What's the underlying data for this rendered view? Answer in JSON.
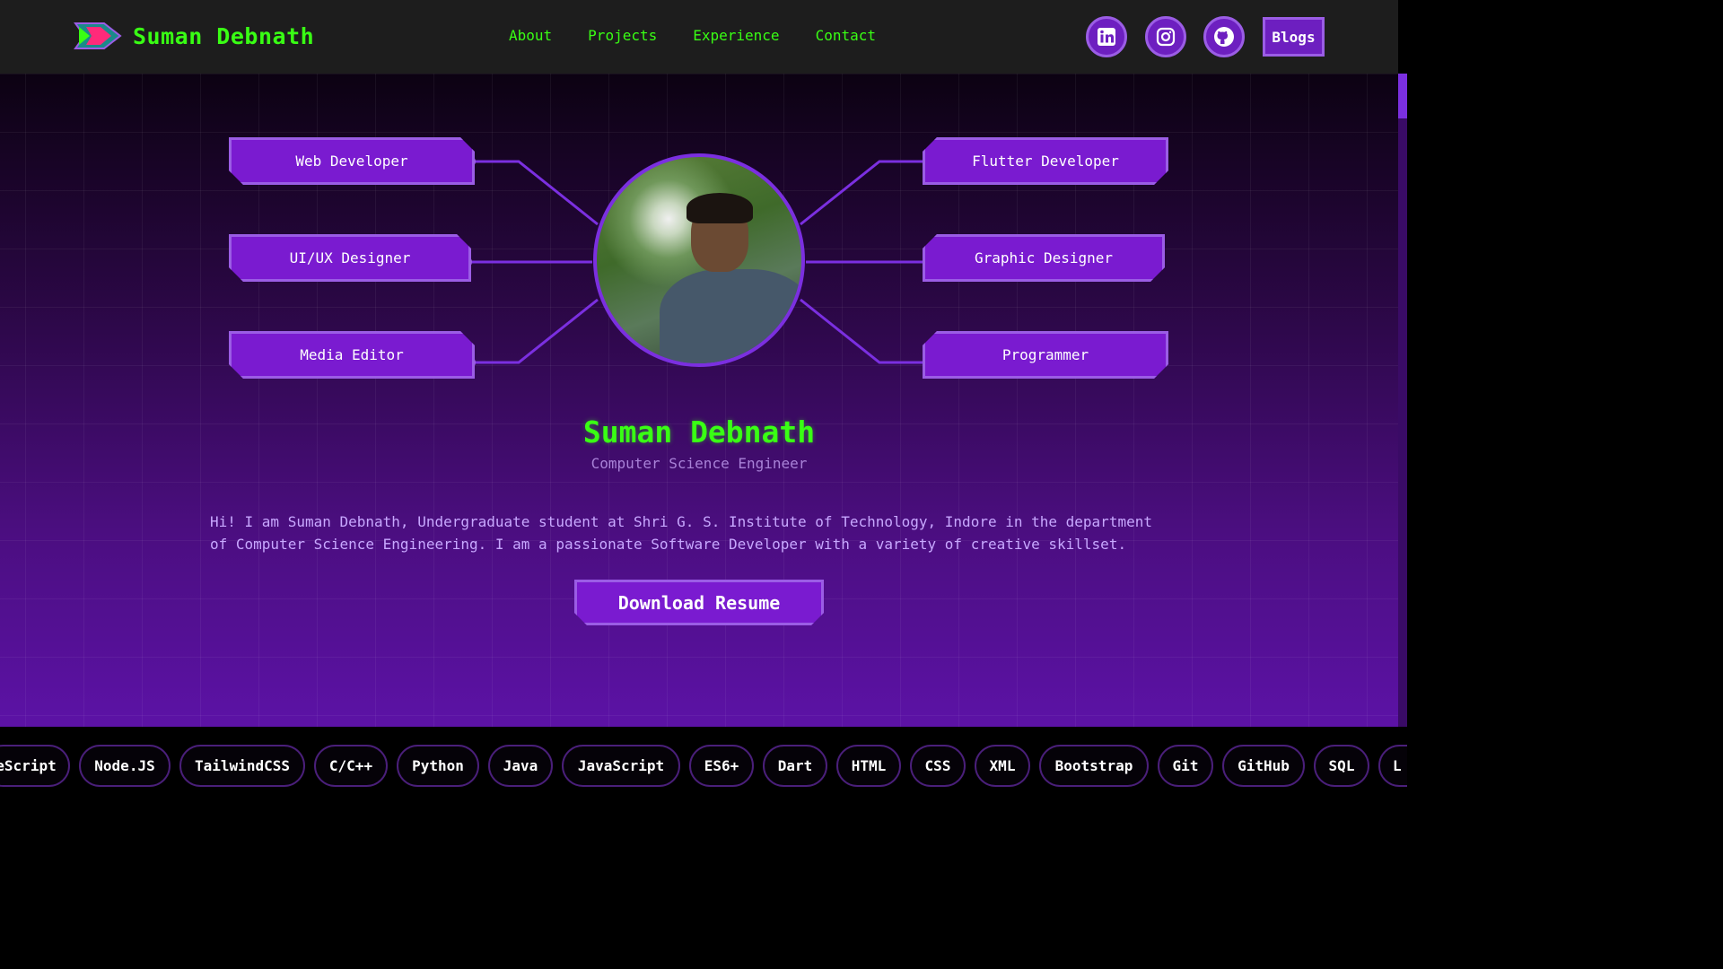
{
  "header": {
    "brand": "Suman Debnath",
    "nav": [
      "About",
      "Projects",
      "Experience",
      "Contact"
    ],
    "socials": [
      "linkedin-icon",
      "instagram-icon",
      "github-icon"
    ],
    "blogs_label": "Blogs"
  },
  "roles": {
    "left": [
      "Web Developer",
      "UI/UX Designer",
      "Media Editor"
    ],
    "right": [
      "Flutter Developer",
      "Graphic Designer",
      "Programmer"
    ]
  },
  "profile": {
    "name": "Suman Debnath",
    "subtitle": "Computer Science Engineer",
    "bio_line1": "Hi! I am Suman Debnath, Undergraduate student at Shri G. S. Institute of Technology, Indore in the department",
    "bio_line2": "of Computer Science Engineering. I am a passionate Software Developer with a variety of creative skillset."
  },
  "cta": {
    "download_label": "Download Resume"
  },
  "skills": [
    "eScript",
    "Node.JS",
    "TailwindCSS",
    "C/C++",
    "Python",
    "Java",
    "JavaScript",
    "ES6+",
    "Dart",
    "HTML",
    "CSS",
    "XML",
    "Bootstrap",
    "Git",
    "GitHub",
    "SQL",
    "L"
  ],
  "colors": {
    "accent_green": "#39ff14",
    "purple": "#7a1bd0",
    "purple_border": "#9b5de5"
  }
}
